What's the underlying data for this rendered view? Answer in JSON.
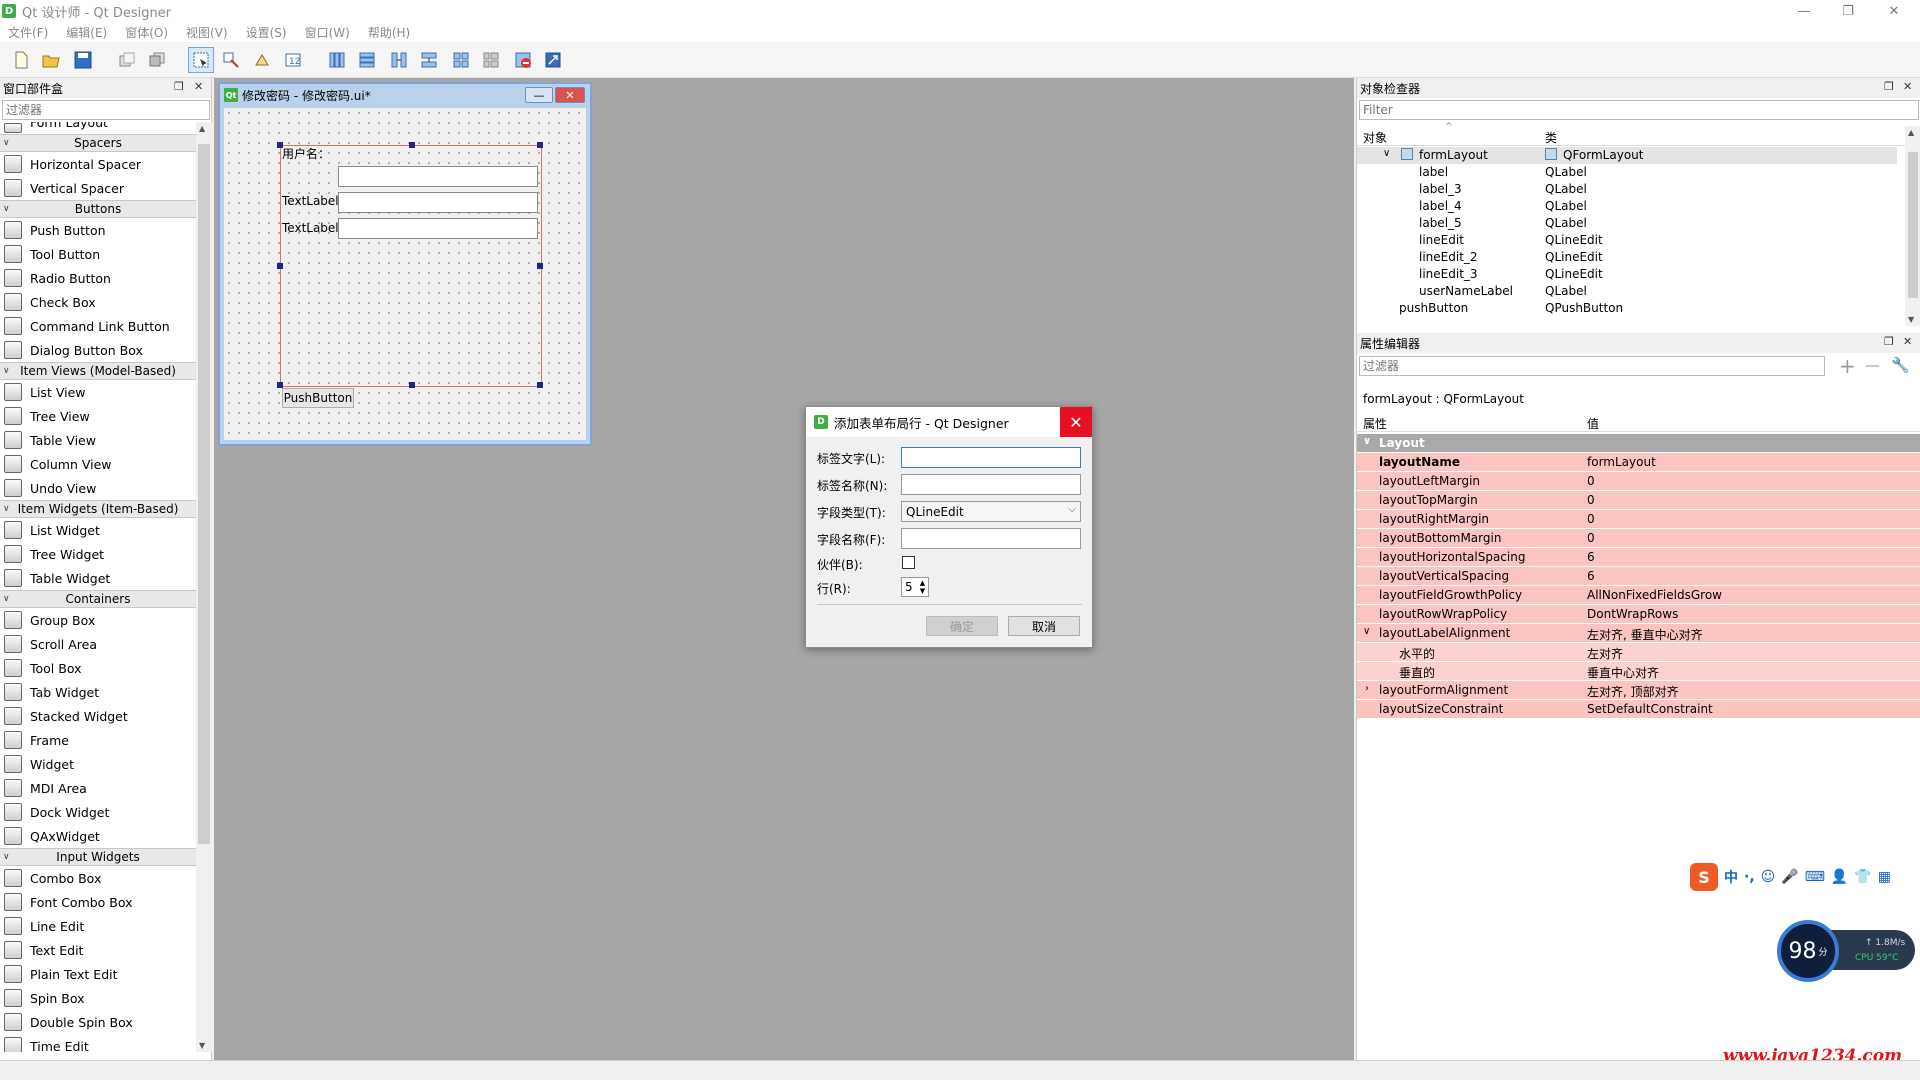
{
  "window": {
    "app_icon": "D",
    "title": "Qt 设计师 - Qt Designer",
    "controls": [
      "—",
      "❐",
      "✕"
    ]
  },
  "menubar": [
    "文件(F)",
    "编辑(E)",
    "窗体(O)",
    "视图(V)",
    "设置(S)",
    "窗口(W)",
    "帮助(H)"
  ],
  "toolbar": {
    "icons": [
      "new-file-icon",
      "open-folder-icon",
      "save-icon",
      "send-to-back-icon",
      "bring-to-front-icon",
      "edit-widgets-icon",
      "edit-signals-slots-icon",
      "edit-buddies-icon",
      "edit-tab-order-icon",
      "layout-horizontal-icon",
      "layout-vertical-icon",
      "layout-horizontal-splitter-icon",
      "layout-vertical-splitter-icon",
      "layout-grid-icon",
      "layout-form-icon",
      "break-layout-icon",
      "adjust-size-icon"
    ]
  },
  "widget_box": {
    "title": "窗口部件盒",
    "filter_placeholder": "过滤器",
    "partial_top_item": "Form Layout",
    "categories": [
      {
        "name": "Spacers",
        "items": [
          "Horizontal Spacer",
          "Vertical Spacer"
        ]
      },
      {
        "name": "Buttons",
        "items": [
          "Push Button",
          "Tool Button",
          "Radio Button",
          "Check Box",
          "Command Link Button",
          "Dialog Button Box"
        ]
      },
      {
        "name": "Item Views (Model-Based)",
        "items": [
          "List View",
          "Tree View",
          "Table View",
          "Column View",
          "Undo View"
        ]
      },
      {
        "name": "Item Widgets (Item-Based)",
        "items": [
          "List Widget",
          "Tree Widget",
          "Table Widget"
        ]
      },
      {
        "name": "Containers",
        "items": [
          "Group Box",
          "Scroll Area",
          "Tool Box",
          "Tab Widget",
          "Stacked Widget",
          "Frame",
          "Widget",
          "MDI Area",
          "Dock Widget",
          "QAxWidget"
        ]
      },
      {
        "name": "Input Widgets",
        "items": [
          "Combo Box",
          "Font Combo Box",
          "Line Edit",
          "Text Edit",
          "Plain Text Edit",
          "Spin Box",
          "Double Spin Box",
          "Time Edit"
        ]
      }
    ]
  },
  "form_window": {
    "badge": "Qt",
    "title": "修改密码 - 修改密码.ui*",
    "minimize": "—",
    "close": "✕",
    "labels": [
      "用户名：",
      "TextLabel",
      "TextLabel"
    ],
    "push_button": "PushButton"
  },
  "dialog": {
    "icon": "D",
    "title": "添加表单布局行 - Qt Designer",
    "close": "✕",
    "fields": {
      "label_text": {
        "label": "标签文字(L):",
        "value": ""
      },
      "label_name": {
        "label": "标签名称(N):",
        "value": ""
      },
      "field_type": {
        "label": "字段类型(T):",
        "value": "QLineEdit"
      },
      "field_name": {
        "label": "字段名称(F):",
        "value": ""
      },
      "buddy": {
        "label": "伙伴(B):",
        "checked": false
      },
      "row": {
        "label": "行(R):",
        "value": "5"
      }
    },
    "ok_label": "确定",
    "cancel_label": "取消"
  },
  "object_inspector": {
    "title": "对象检查器",
    "filter_placeholder": "Filter",
    "col_object": "对象",
    "col_class": "类",
    "rows": [
      {
        "name": "formLayout",
        "cls": "QFormLayout",
        "level": 1,
        "expanded": true,
        "selected": true
      },
      {
        "name": "label",
        "cls": "QLabel",
        "level": 2
      },
      {
        "name": "label_3",
        "cls": "QLabel",
        "level": 2
      },
      {
        "name": "label_4",
        "cls": "QLabel",
        "level": 2
      },
      {
        "name": "label_5",
        "cls": "QLabel",
        "level": 2
      },
      {
        "name": "lineEdit",
        "cls": "QLineEdit",
        "level": 2
      },
      {
        "name": "lineEdit_2",
        "cls": "QLineEdit",
        "level": 2
      },
      {
        "name": "lineEdit_3",
        "cls": "QLineEdit",
        "level": 2
      },
      {
        "name": "userNameLabel",
        "cls": "QLabel",
        "level": 2
      },
      {
        "name": "pushButton",
        "cls": "QPushButton",
        "level": 1
      }
    ]
  },
  "property_editor": {
    "title": "属性编辑器",
    "filter_placeholder": "过滤器",
    "add": "+",
    "remove": "—",
    "context": "formLayout : QFormLayout",
    "col_property": "属性",
    "col_value": "值",
    "group": "Layout",
    "rows": [
      {
        "name": "layoutName",
        "value": "formLayout",
        "bold": true
      },
      {
        "name": "layoutLeftMargin",
        "value": "0"
      },
      {
        "name": "layoutTopMargin",
        "value": "0"
      },
      {
        "name": "layoutRightMargin",
        "value": "0"
      },
      {
        "name": "layoutBottomMargin",
        "value": "0"
      },
      {
        "name": "layoutHorizontalSpacing",
        "value": "6"
      },
      {
        "name": "layoutVerticalSpacing",
        "value": "6"
      },
      {
        "name": "layoutFieldGrowthPolicy",
        "value": "AllNonFixedFieldsGrow"
      },
      {
        "name": "layoutRowWrapPolicy",
        "value": "DontWrapRows"
      },
      {
        "name": "layoutLabelAlignment",
        "value": "左对齐, 垂直中心对齐",
        "expand": "open"
      },
      {
        "name": "水平的",
        "value": "左对齐",
        "sub": true
      },
      {
        "name": "垂直的",
        "value": "垂直中心对齐",
        "sub": true
      },
      {
        "name": "layoutFormAlignment",
        "value": "左对齐, 顶部对齐",
        "expand": "closed"
      },
      {
        "name": "layoutSizeConstraint",
        "value": "SetDefaultConstraint"
      }
    ]
  },
  "ime": {
    "logo": "S",
    "items": [
      "中",
      "·,",
      "☺",
      "🎤",
      "⌨",
      "👤",
      "👕",
      "▦"
    ]
  },
  "speed_gadget": {
    "score": "98",
    "unit": "分",
    "net": "↑ 1.8M/s",
    "cpu": "CPU 59°C"
  },
  "watermark": "www.java1234.com",
  "colors": {
    "close_red": "#e81123",
    "prop_row": "#fcc4c0",
    "layout_box": "#e56a6a",
    "handle": "#1b2a80"
  }
}
